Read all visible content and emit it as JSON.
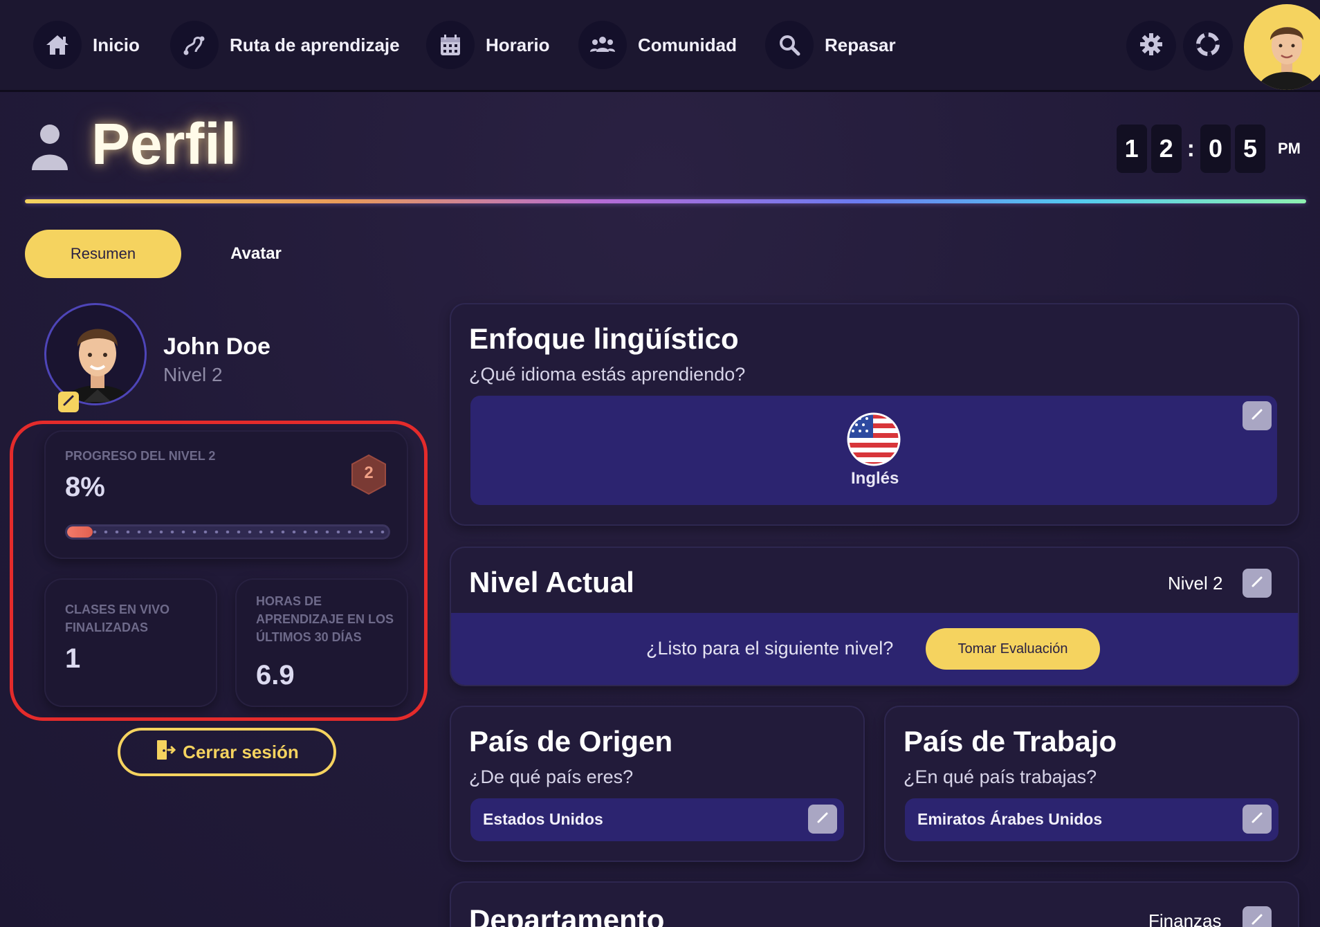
{
  "nav": {
    "items": [
      {
        "label": "Inicio",
        "icon": "home-icon"
      },
      {
        "label": "Ruta de aprendizaje",
        "icon": "route-icon"
      },
      {
        "label": "Horario",
        "icon": "calendar-icon"
      },
      {
        "label": "Comunidad",
        "icon": "community-icon"
      },
      {
        "label": "Repasar",
        "icon": "search-icon"
      }
    ],
    "settings_icon": "gear-icon",
    "help_icon": "lifebuoy-icon"
  },
  "header": {
    "title": "Perfil",
    "clock": {
      "d1": "1",
      "d2": "2",
      "sep": ":",
      "d3": "0",
      "d4": "5",
      "ampm": "PM"
    }
  },
  "tabs": {
    "active": "Resumen",
    "other": "Avatar"
  },
  "user": {
    "name": "John Doe",
    "level": "Nivel 2"
  },
  "stats": {
    "progress_label": "PROGRESO DEL NIVEL 2",
    "progress_value": "8%",
    "progress_fraction": 0.08,
    "level_badge": "2",
    "classes_label": "CLASES EN VIVO FINALIZADAS",
    "classes_value": "1",
    "hours_label": "HORAS DE APRENDIZAJE EN LOS ÚLTIMOS 30 DÍAS",
    "hours_value": "6.9"
  },
  "logout_label": "Cerrar sesión",
  "language_card": {
    "title": "Enfoque lingüístico",
    "subtitle": "¿Qué idioma estás aprendiendo?",
    "language": "Inglés"
  },
  "level_card": {
    "title": "Nivel Actual",
    "current": "Nivel 2",
    "ready_text": "¿Listo para el siguiente nivel?",
    "eval_button": "Tomar Evaluación"
  },
  "origin_card": {
    "title": "País de Origen",
    "subtitle": "¿De qué país eres?",
    "value": "Estados Unidos"
  },
  "work_card": {
    "title": "País de Trabajo",
    "subtitle": "¿En qué país trabajas?",
    "value": "Emiratos Árabes Unidos"
  },
  "department_card": {
    "title": "Departamento",
    "value": "Finanzas"
  },
  "colors": {
    "accent": "#f5d35f",
    "highlight": "#e42b2b",
    "panel": "#2c2470"
  }
}
